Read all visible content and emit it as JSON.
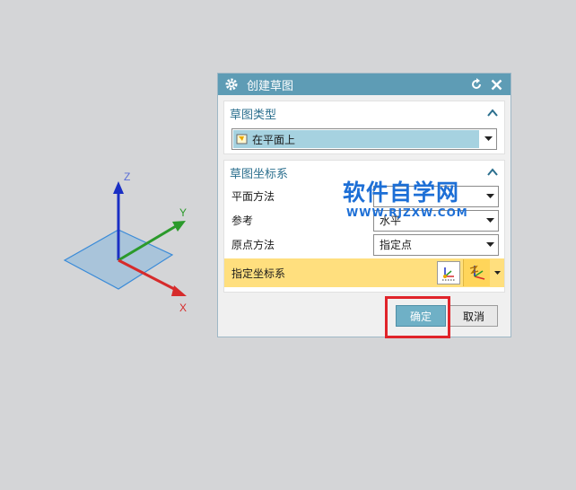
{
  "triad": {
    "axis_x": "X",
    "axis_y": "Y",
    "axis_z": "Z",
    "colors": {
      "x": "#d62b2b",
      "y": "#2b9a2b",
      "z": "#1a2fc4",
      "plane": "#9fbfd8"
    }
  },
  "dialog": {
    "title": "创建草图",
    "icons": {
      "gear": "gear-icon",
      "reset": "reset-icon",
      "close": "close-icon"
    },
    "sketch_type": {
      "header": "草图类型",
      "selected": "在平面上"
    },
    "sketch_csys": {
      "header": "草图坐标系",
      "rows": [
        {
          "label": "平面方法",
          "value": ""
        },
        {
          "label": "参考",
          "value": "水平"
        },
        {
          "label": "原点方法",
          "value": "指定点"
        }
      ],
      "specify_csys": {
        "label": "指定坐标系"
      }
    },
    "buttons": {
      "ok": "确定",
      "cancel": "取消"
    }
  },
  "watermark": {
    "main": "软件自学网",
    "sub": "WWW.RJZXW.COM"
  },
  "colors": {
    "titlebar": "#5e9cb5",
    "header_text": "#2b6f8e",
    "highlight": "#ffdf7e",
    "annotation": "#e0242a"
  }
}
